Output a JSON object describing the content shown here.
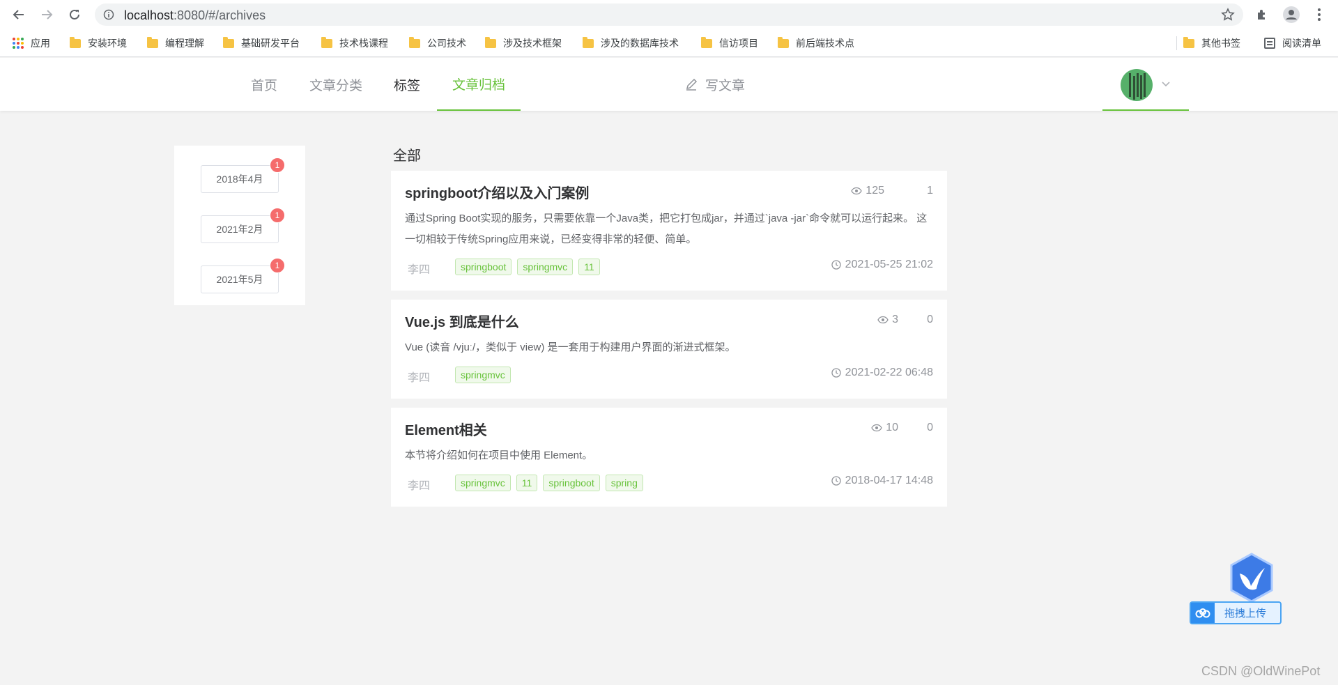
{
  "browser": {
    "url_host": "localhost",
    "url_rest": ":8080/#/archives",
    "bookmarks": [
      {
        "label": "应用"
      },
      {
        "label": "安装环境"
      },
      {
        "label": "编程理解"
      },
      {
        "label": "基础研发平台"
      },
      {
        "label": "技术栈课程"
      },
      {
        "label": "公司技术"
      },
      {
        "label": "涉及技术框架"
      },
      {
        "label": "涉及的数据库技术"
      },
      {
        "label": "信访项目"
      },
      {
        "label": "前后端技术点"
      },
      {
        "label": "其他书签"
      },
      {
        "label": "阅读清单"
      }
    ]
  },
  "nav": {
    "items": [
      {
        "label": "首页"
      },
      {
        "label": "文章分类"
      },
      {
        "label": "标签"
      },
      {
        "label": "文章归档"
      }
    ],
    "write_label": "写文章",
    "accent_color": "#67c23a"
  },
  "archive": {
    "months": [
      {
        "label": "2018年4月",
        "count": "1"
      },
      {
        "label": "2021年2月",
        "count": "1"
      },
      {
        "label": "2021年5月",
        "count": "1"
      }
    ]
  },
  "main": {
    "section_title": "全部",
    "articles": [
      {
        "title": "springboot介绍以及入门案例",
        "views": "125",
        "comments": "1",
        "summary": "通过Spring Boot实现的服务，只需要依靠一个Java类，把它打包成jar，并通过`java -jar`命令就可以运行起来。 这一切相较于传统Spring应用来说，已经变得非常的轻便、简单。",
        "author": "李四",
        "tags": [
          "springboot",
          "springmvc",
          "11"
        ],
        "date": "2021-05-25 21:02"
      },
      {
        "title": "Vue.js 到底是什么",
        "views": "3",
        "comments": "0",
        "summary": "Vue (读音 /vjuː/，类似于 view) 是一套用于构建用户界面的渐进式框架。",
        "author": "李四",
        "tags": [
          "springmvc"
        ],
        "date": "2021-02-22 06:48"
      },
      {
        "title": "Element相关",
        "views": "10",
        "comments": "0",
        "summary": "本节将介绍如何在项目中使用 Element。",
        "author": "李四",
        "tags": [
          "springmvc",
          "11",
          "springboot",
          "spring"
        ],
        "date": "2018-04-17 14:48"
      }
    ]
  },
  "widget": {
    "upload_label": "拖拽上传"
  },
  "watermark": "CSDN @OldWinePot"
}
